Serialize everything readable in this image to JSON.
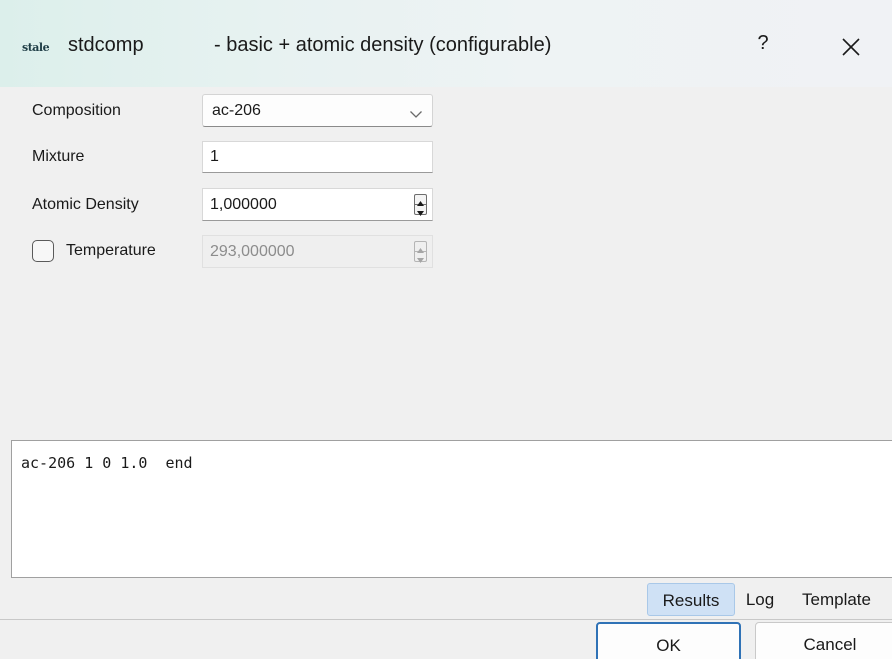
{
  "window": {
    "logo_text": "stale",
    "app_name": "stdcomp",
    "title_suffix": "- basic + atomic density (configurable)",
    "help_label": "?"
  },
  "form": {
    "composition": {
      "label": "Composition",
      "value": "ac-206"
    },
    "mixture": {
      "label": "Mixture",
      "value": "1"
    },
    "atomic_density": {
      "label": "Atomic Density",
      "value": "1,000000"
    },
    "temperature": {
      "label": "Temperature",
      "value": "293,000000",
      "enabled": false,
      "checked": false
    }
  },
  "output": {
    "text": "ac-206 1 0 1.0  end"
  },
  "tabs": [
    {
      "label": "Results",
      "selected": true
    },
    {
      "label": "Log",
      "selected": false
    },
    {
      "label": "Template",
      "selected": false
    }
  ],
  "buttons": {
    "ok_label": "OK",
    "cancel_label": "Cancel"
  },
  "colors": {
    "selected_tab": "#cfe1f5",
    "default_button_border": "#2f72b6",
    "titlebar_tint": "#dcefeb"
  },
  "icons": {
    "combo_arrow": "chevron-down-icon",
    "close": "close-icon",
    "spin": "spin-arrows-icon"
  }
}
